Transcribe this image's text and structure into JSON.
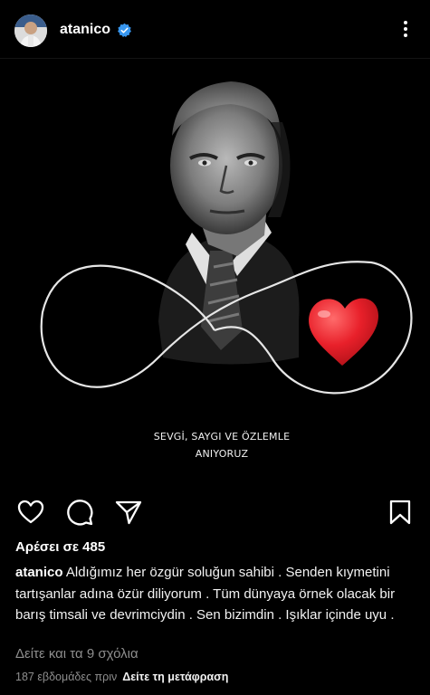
{
  "header": {
    "username": "atanico"
  },
  "post": {
    "image_caption_line1": "SEVGİ, SAYGI VE ÖZLEMLE",
    "image_caption_line2": "ANIYORUZ"
  },
  "likes": {
    "text": "Αρέσει σε 485"
  },
  "caption": {
    "username": "atanico",
    "text": "Aldığımız her özgür soluğun sahibi . Senden kıymetini tartışanlar adına özür diliyorum . Tüm dünyaya örnek olacak bir barış timsali ve devrimciydin . Sen bizimdin . Işıklar içinde uyu ."
  },
  "comments": {
    "label": "Δείτε και τα 9 σχόλια"
  },
  "footer": {
    "time": "187 εβδομάδες πριν",
    "translate": "Δείτε τη μετάφραση"
  },
  "icons": {
    "verified": "verified-badge-icon",
    "more": "more-vertical-icon",
    "like": "heart-outline-icon",
    "comment": "comment-bubble-icon",
    "share": "paper-plane-icon",
    "save": "bookmark-icon"
  },
  "colors": {
    "background": "#000000",
    "verified_blue": "#3897f0",
    "heart_red": "#e8202a",
    "muted": "#8e8e8e"
  }
}
